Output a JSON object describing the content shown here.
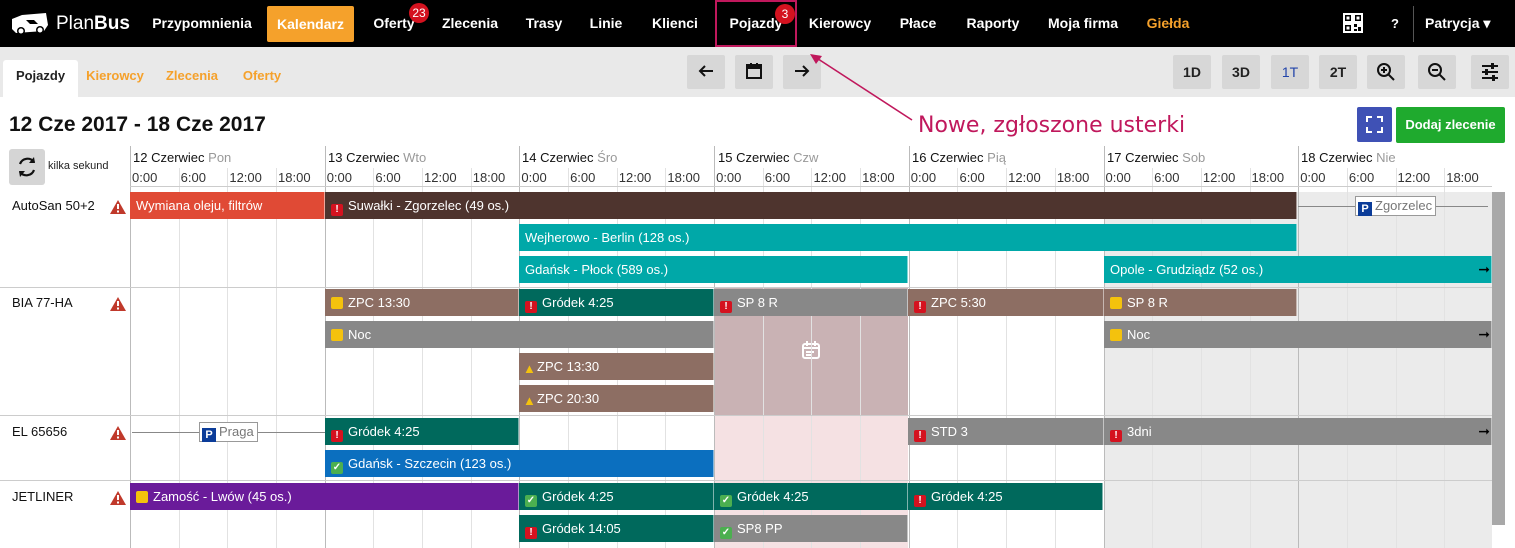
{
  "brand": {
    "name_light": "Plan",
    "name_bold": "Bus"
  },
  "nav": {
    "items": [
      {
        "label": "Przypomnienia"
      },
      {
        "label": "Kalendarz"
      },
      {
        "label": "Oferty",
        "badge": "23"
      },
      {
        "label": "Zlecenia"
      },
      {
        "label": "Trasy"
      },
      {
        "label": "Linie"
      },
      {
        "label": "Klienci"
      },
      {
        "label": "Pojazdy",
        "badge": "3"
      },
      {
        "label": "Kierowcy"
      },
      {
        "label": "Płace"
      },
      {
        "label": "Raporty"
      },
      {
        "label": "Moja firma"
      },
      {
        "label": "Giełda"
      }
    ],
    "help": "?",
    "user": "Patrycja ▾"
  },
  "subnav": {
    "tabs": [
      "Pojazdy",
      "Kierowcy",
      "Zlecenia",
      "Oferty"
    ],
    "zoom_buttons": [
      "1D",
      "3D",
      "1T",
      "2T"
    ]
  },
  "header": {
    "range_title": "12 Cze 2017 - 18 Cze 2017",
    "annotation": "Nowe, zgłoszone usterki",
    "add_order": "Dodaj zlecenie",
    "refresh_label": "kilka sekund"
  },
  "days": [
    {
      "date": "12 Czerwiec",
      "weekday": "Pon"
    },
    {
      "date": "13 Czerwiec",
      "weekday": "Wto"
    },
    {
      "date": "14 Czerwiec",
      "weekday": "Śro"
    },
    {
      "date": "15 Czerwiec",
      "weekday": "Czw"
    },
    {
      "date": "16 Czerwiec",
      "weekday": "Pią"
    },
    {
      "date": "17 Czerwiec",
      "weekday": "Sob"
    },
    {
      "date": "18 Czerwiec",
      "weekday": "Nie"
    }
  ],
  "hours": [
    "0:00",
    "6:00",
    "12:00",
    "18:00"
  ],
  "colors": {
    "accent": "#f5a12b",
    "red": "#e04a35",
    "brown_dark": "#4e342e",
    "teal": "#00a8a8",
    "brown": "#8d6e63",
    "teal_dark": "#00695c",
    "gray": "#888888",
    "blue": "#0b6fbf",
    "purple": "#6a1b9a"
  },
  "vehicles": [
    {
      "name": "AutoSan 50+2"
    },
    {
      "name": "BIA 77-HA"
    },
    {
      "name": "EL 65656"
    },
    {
      "name": "JETLINER"
    }
  ],
  "events": {
    "e1": "Wymiana oleju, filtrów",
    "e2": "Suwałki - Zgorzelec (49 os.)",
    "e3": "Wejherowo - Berlin (128 os.)",
    "e4": "Gdańsk - Płock (589 os.)",
    "e5": "Opole - Grudziądz (52 os.)",
    "e6": "ZPC 13:30",
    "e7": "Gródek 4:25",
    "e8": "SP 8 R",
    "e9": "ZPC 5:30",
    "e10": "SP 8 R",
    "e11": "Noc",
    "e12": "Noc",
    "e13": "ZPC 13:30",
    "e14": "ZPC 20:30",
    "e15": "Gródek 4:25",
    "e16": "STD 3",
    "e17": "3dni",
    "e18": "Gdańsk - Szczecin (123 os.)",
    "e19": "Zamość - Lwów (45 os.)",
    "e20": "Gródek 4:25",
    "e21": "Gródek 4:25",
    "e22": "Gródek 4:25",
    "e23": "Gródek 14:05",
    "e24": "SP8 PP"
  },
  "parking": {
    "p1": "Zgorzelec",
    "p2": "Praga",
    "p_symbol": "P"
  }
}
